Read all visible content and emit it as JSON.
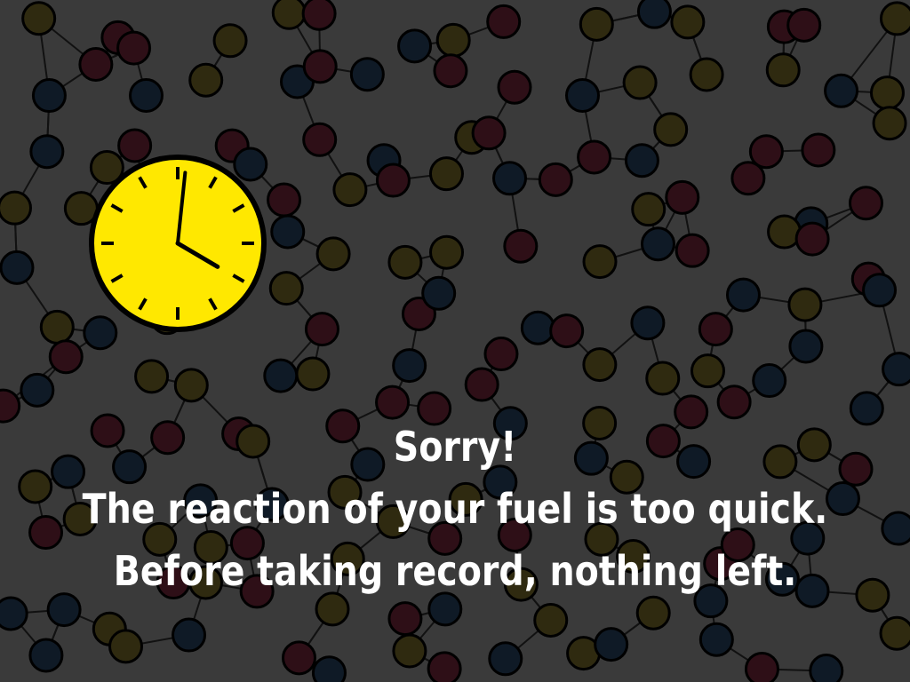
{
  "scene": {
    "background_color": "#3a3a3a",
    "node_colors": [
      "#0f1a26",
      "#2f2a10",
      "#2e0f17"
    ],
    "edge_color": "#111111"
  },
  "clock": {
    "face_color": "#ffe800",
    "icon": "clock-icon",
    "hour": 4,
    "minute": 1
  },
  "message": {
    "title": "Sorry!",
    "line1": "The reaction of your fuel is too quick.",
    "line2": "Before taking record, nothing left."
  }
}
